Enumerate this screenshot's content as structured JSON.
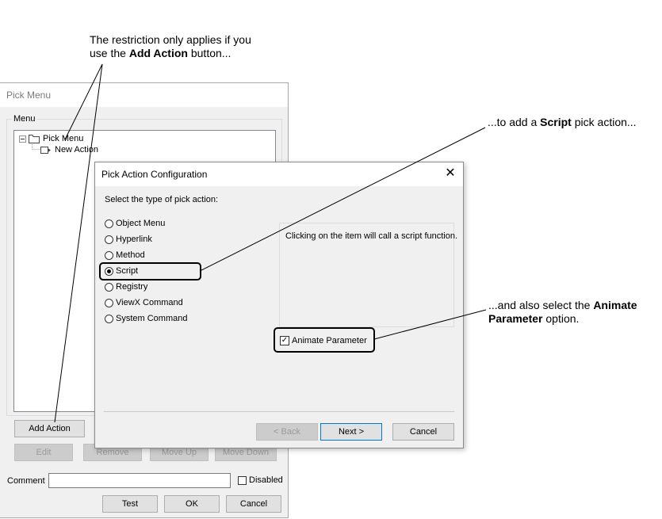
{
  "callouts": {
    "c1_line1": "The restriction only applies if you",
    "c1_line2_pre": "use the ",
    "c1_line2_bold": "Add Action",
    "c1_line2_post": " button...",
    "c2_pre": "...to add a ",
    "c2_bold": "Script",
    "c2_post": " pick action...",
    "c3_line1_pre": "...and also select the ",
    "c3_line1_bold": "Animate",
    "c3_line2_bold": "Parameter",
    "c3_line2_post": " option."
  },
  "pick_menu": {
    "title": "Pick Menu",
    "group_label": "Menu",
    "tree": {
      "root": "Pick Menu",
      "child": "New Action"
    },
    "buttons": {
      "add_action": "Add Action",
      "edit": "Edit",
      "remove": "Remove",
      "move_up": "Move Up",
      "move_down": "Move Down"
    },
    "comment_label": "Comment",
    "comment_value": "",
    "disabled_label": "Disabled",
    "test": "Test",
    "ok": "OK",
    "cancel": "Cancel"
  },
  "dialog": {
    "title": "Pick Action Configuration",
    "close_glyph": "✕",
    "prompt": "Select the type of pick action:",
    "options": [
      "Object Menu",
      "Hyperlink",
      "Method",
      "Script",
      "Registry",
      "ViewX Command",
      "System Command"
    ],
    "selected": "Script",
    "description": "Clicking on the item will call a script function.",
    "animate_label": "Animate Parameter",
    "animate_checked": true,
    "check_glyph": "✓",
    "back": "< Back",
    "next": "Next >",
    "cancel": "Cancel"
  }
}
